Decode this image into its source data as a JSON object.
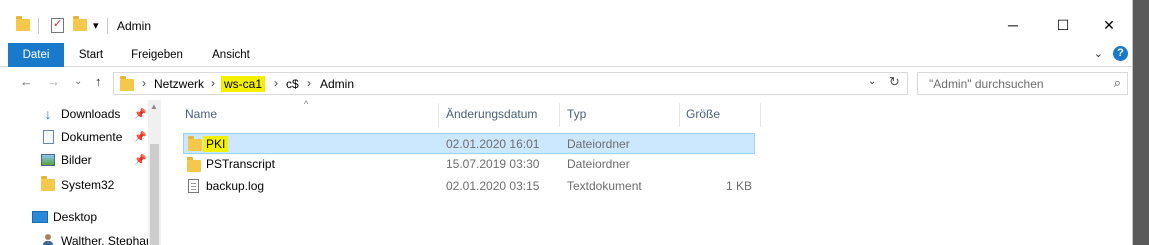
{
  "window": {
    "title": "Admin",
    "qa_dropdown_glyph": "▾",
    "minimize_glyph": "─",
    "maximize_glyph": "☐",
    "close_glyph": "✕"
  },
  "ribbon": {
    "tabs": [
      {
        "label": "Datei",
        "active": true
      },
      {
        "label": "Start",
        "active": false
      },
      {
        "label": "Freigeben",
        "active": false
      },
      {
        "label": "Ansicht",
        "active": false
      }
    ],
    "expand_glyph": "⌄",
    "help_glyph": "?"
  },
  "nav_buttons": {
    "back": "←",
    "forward": "→",
    "recent": "⌄",
    "up": "↑"
  },
  "address": {
    "crumbs": [
      "Netzwerk",
      "ws-ca1",
      "c$",
      "Admin"
    ],
    "highlighted_crumb": "ws-ca1",
    "separator": "›",
    "dropdown_glyph": "⌄",
    "refresh_glyph": "↻"
  },
  "search": {
    "placeholder": "\"Admin\" durchsuchen",
    "icon": "search-icon",
    "glyph": "⌕"
  },
  "nav_pane": {
    "items": [
      {
        "label": "Downloads",
        "icon": "download-icon",
        "pinned": true
      },
      {
        "label": "Dokumente",
        "icon": "documents-icon",
        "pinned": true
      },
      {
        "label": "Bilder",
        "icon": "pictures-icon",
        "pinned": true
      },
      {
        "label": "System32",
        "icon": "folder-icon",
        "pinned": false
      },
      {
        "label": "Desktop",
        "icon": "desktop-icon",
        "pinned": false
      },
      {
        "label": "Walther, Stephan",
        "icon": "user-icon",
        "pinned": false
      }
    ],
    "pin_glyph": "📌",
    "scroll_up_glyph": "▲"
  },
  "columns": {
    "name": "Name",
    "date": "Änderungsdatum",
    "type": "Typ",
    "size": "Größe",
    "sort_glyph": "^"
  },
  "files": [
    {
      "name": "PKI",
      "date": "02.01.2020 16:01",
      "type": "Dateiordner",
      "size": "",
      "icon": "folder-icon",
      "selected": true,
      "highlighted": true
    },
    {
      "name": "PSTranscript",
      "date": "15.07.2019 03:30",
      "type": "Dateiordner",
      "size": "",
      "icon": "folder-icon",
      "selected": false,
      "highlighted": false
    },
    {
      "name": "backup.log",
      "date": "02.01.2020 03:15",
      "type": "Textdokument",
      "size": "1 KB",
      "icon": "text-file-icon",
      "selected": false,
      "highlighted": false
    }
  ],
  "colors": {
    "accent": "#1979ca",
    "selection_bg": "#cce8ff",
    "highlight": "#f3f000",
    "folder": "#f5c84c"
  }
}
